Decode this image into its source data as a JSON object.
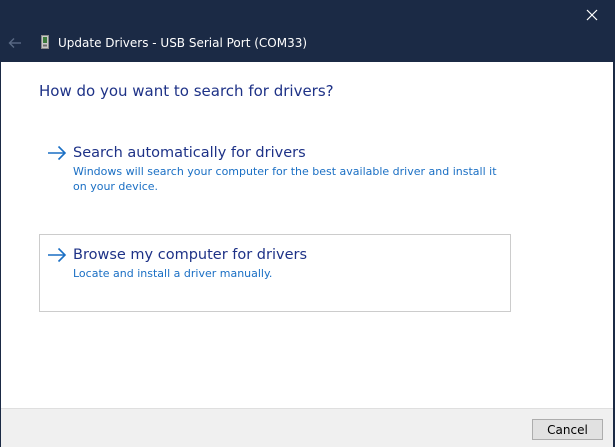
{
  "window": {
    "title": "Update Drivers - USB Serial Port (COM33)",
    "icons": {
      "close": "close-icon",
      "back": "back-arrow-icon",
      "device": "usb-device-icon"
    }
  },
  "main": {
    "heading": "How do you want to search for drivers?",
    "options": [
      {
        "title": "Search automatically for drivers",
        "description": "Windows will search your computer for the best available driver and install it on your device.",
        "icon": "right-arrow-icon"
      },
      {
        "title": "Browse my computer for drivers",
        "description": "Locate and install a driver manually.",
        "icon": "right-arrow-icon"
      }
    ]
  },
  "footer": {
    "cancel_label": "Cancel"
  },
  "colors": {
    "titlebar": "#1b2a45",
    "heading": "#1e3287",
    "link_description": "#1a6fc4",
    "arrow": "#1a6fc4"
  }
}
